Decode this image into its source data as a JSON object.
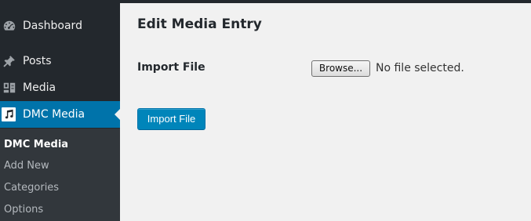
{
  "sidebar": {
    "items": [
      {
        "label": "Dashboard",
        "icon": "dashboard-icon"
      },
      {
        "label": "Posts",
        "icon": "pushpin-icon"
      },
      {
        "label": "Media",
        "icon": "media-icon"
      },
      {
        "label": "DMC Media",
        "icon": "music-note-icon",
        "current": true
      }
    ],
    "submenu": [
      "DMC Media",
      "Add New",
      "Categories",
      "Options"
    ]
  },
  "main": {
    "title": "Edit Media Entry",
    "import_label": "Import File",
    "browse_label": "Browse...",
    "file_status": "No file selected.",
    "submit_label": "Import File"
  },
  "colors": {
    "sidebar_bg": "#23282d",
    "submenu_bg": "#32373c",
    "accent": "#0073aa",
    "button_primary": "#0085ba",
    "content_bg": "#f1f1f1"
  }
}
